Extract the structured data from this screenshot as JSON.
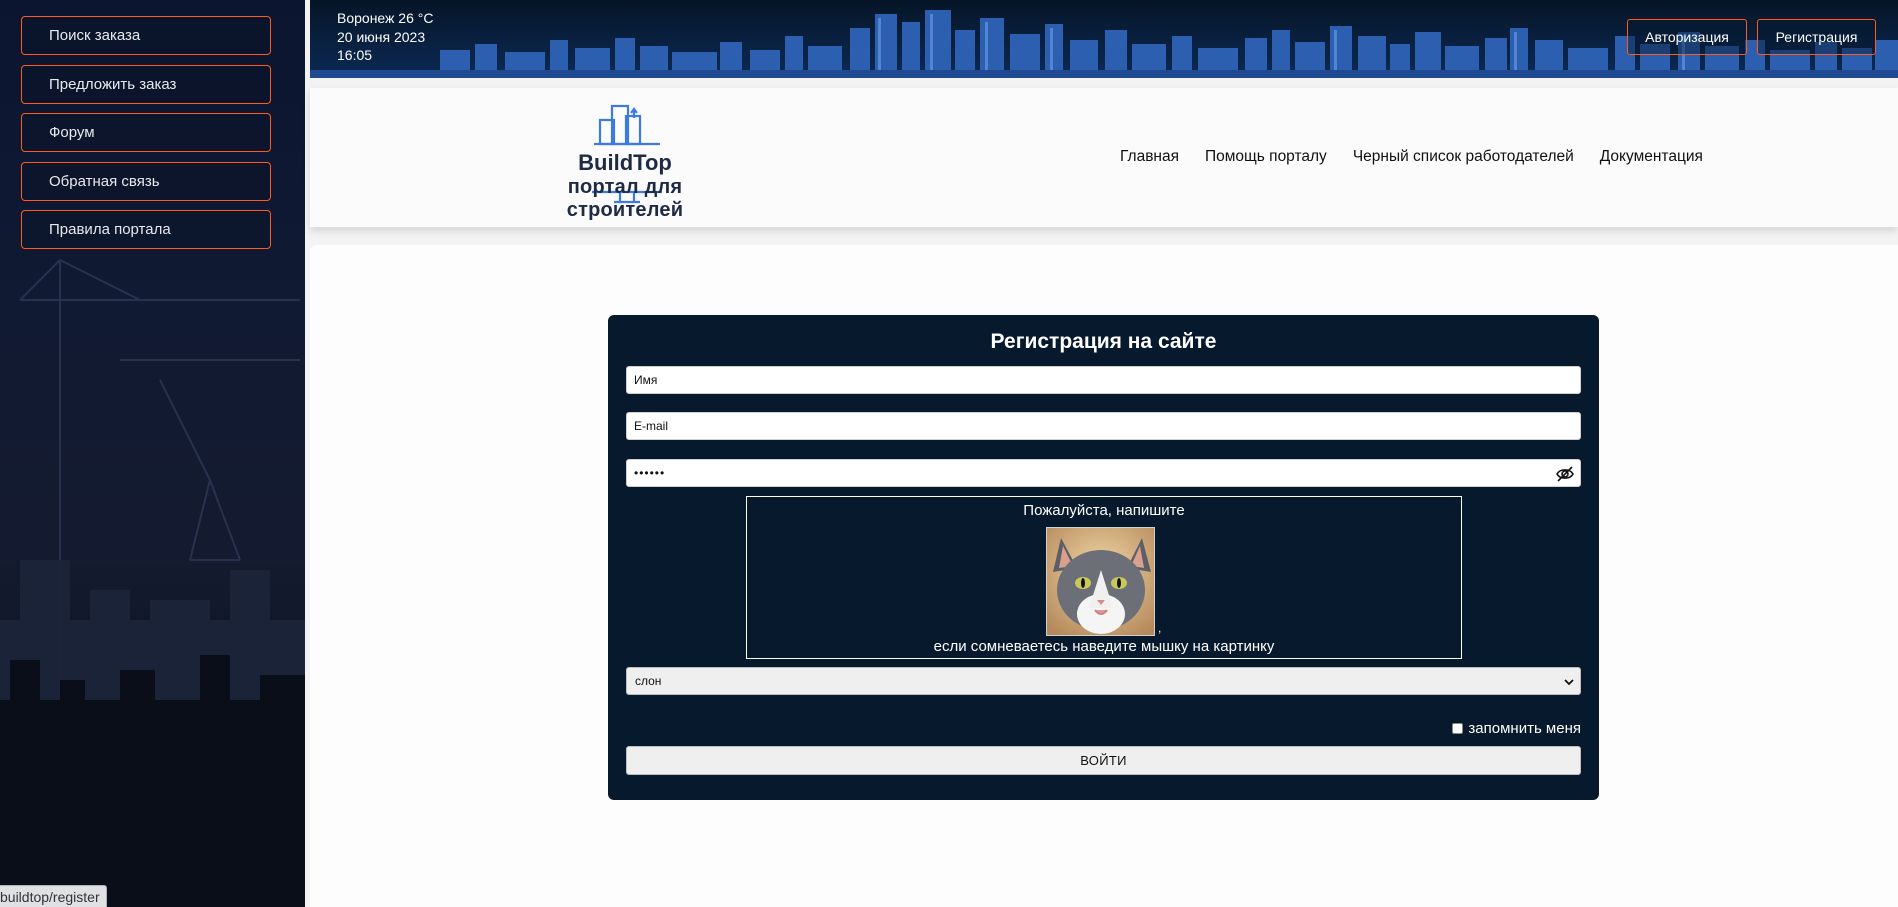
{
  "sidebar": {
    "items": [
      {
        "label": "Поиск заказа"
      },
      {
        "label": "Предложить заказ"
      },
      {
        "label": "Форум"
      },
      {
        "label": "Обратная связь"
      },
      {
        "label": "Правила портала"
      }
    ],
    "status_url": "buildtop/register"
  },
  "banner": {
    "city_temp": "Воронеж  26 °C",
    "date": "20 июня 2023",
    "time": "16:05",
    "login_label": "Авторизация",
    "register_label": "Регистрация"
  },
  "header": {
    "logo_title": "BuildTop",
    "logo_subtitle": "портал для строителей",
    "nav": [
      {
        "label": "Главная"
      },
      {
        "label": "Помощь порталу"
      },
      {
        "label": "Черный список работодателей"
      },
      {
        "label": "Документация"
      }
    ]
  },
  "form": {
    "title": "Регистрация на сайте",
    "name_value": "Имя",
    "email_value": "E-mail",
    "password_masked": "••••••",
    "captcha_prompt": "Пожалуйста, напишите",
    "captcha_comma": ",",
    "captcha_hint": "если сомневаетесь наведите мышку на картинку",
    "captcha_selected": "слон",
    "remember_label": "запомнить меня",
    "submit_label": "ВОЙТИ"
  },
  "colors": {
    "accent_orange": "#ff5a1f",
    "navy": "#071a2d",
    "brand_blue": "#3d7be0"
  }
}
